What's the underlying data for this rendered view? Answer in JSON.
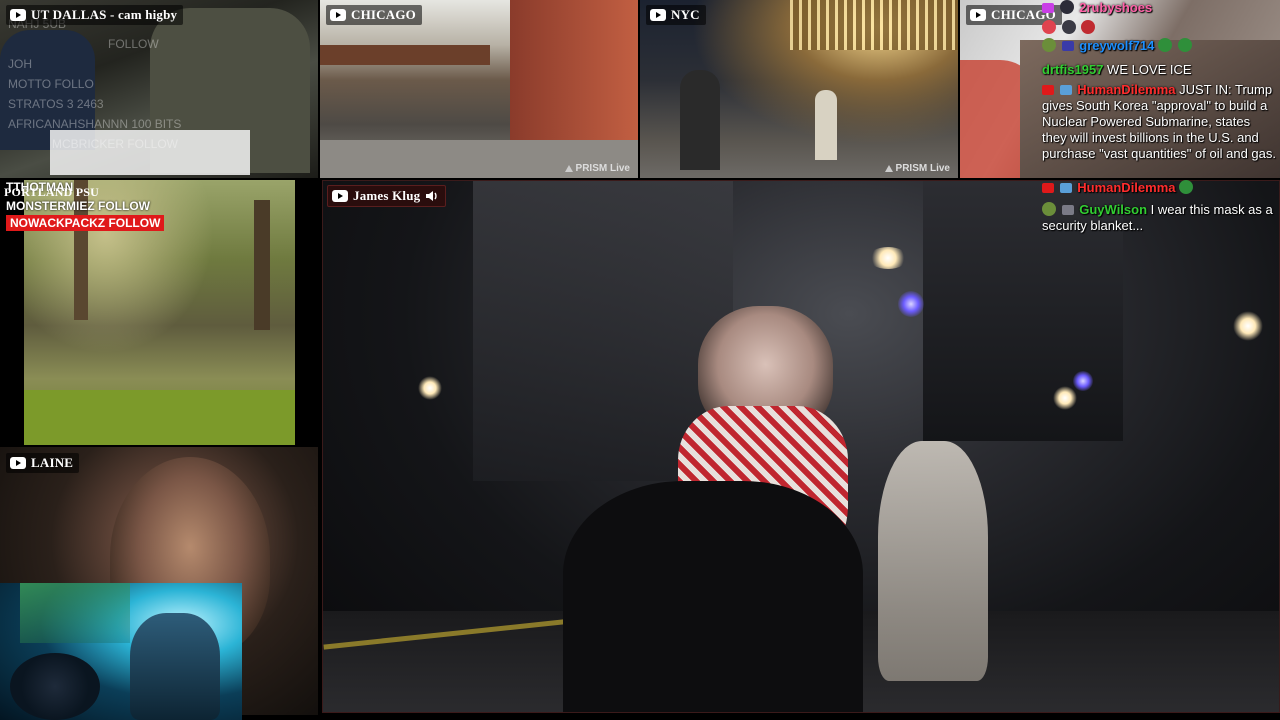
{
  "tiles": {
    "dallas": {
      "label": "UT DALLAS - cam higby"
    },
    "chicago1": {
      "label": "CHICAGO",
      "badge": "PRISM Live"
    },
    "nyc": {
      "label": "NYC",
      "badge": "PRISM Live"
    },
    "chicago2": {
      "label": "CHICAGO"
    },
    "portland": {
      "label": "PORTLAND PSU"
    },
    "laine": {
      "label": "LAINE"
    },
    "main": {
      "label": "James Klug"
    }
  },
  "ticker_faded": [
    "NAHJ 5UB",
    "FOLLOW",
    "JOH",
    "MOTTO   FOLLO",
    "STRATOS 3 2463",
    "AFRICANAHSHANNN  100 BITS",
    "MCBRICKER  FOLLOW"
  ],
  "follow_overlay": {
    "line1": "TTHOTMAN",
    "line2": "MONSTERMIEZ  FOLLOW",
    "highlight": "NOWACKPACKZ  FOLLOW"
  },
  "chat": [
    {
      "user": "2rubyshoes",
      "text": "",
      "color": "#ff62a8"
    },
    {
      "user": "greywolf714",
      "text": "",
      "color": "#1e90ff"
    },
    {
      "user": "drtfis1957",
      "text": "WE LOVE ICE",
      "color": "#32cd32"
    },
    {
      "user": "HumanDilemma",
      "text": "JUST IN: Trump gives South Korea \"approval\" to build a Nuclear Powered Submarine, states they will invest billions in the U.S. and purchase \"vast quantities\" of oil and gas.",
      "color": "#ff2d2d"
    },
    {
      "user": "HumanDilemma",
      "text": "",
      "color": "#ff2d2d"
    },
    {
      "user": "GuyWilson",
      "text": "I wear this mask as a security blanket...",
      "color": "#32cd32"
    }
  ],
  "colors": {
    "accent_red": "#e0191a",
    "frame_border": "#3b1a1a"
  },
  "icons": {
    "youtube": "youtube-icon",
    "speaker": "speaker-icon",
    "prism": "prism-icon"
  }
}
